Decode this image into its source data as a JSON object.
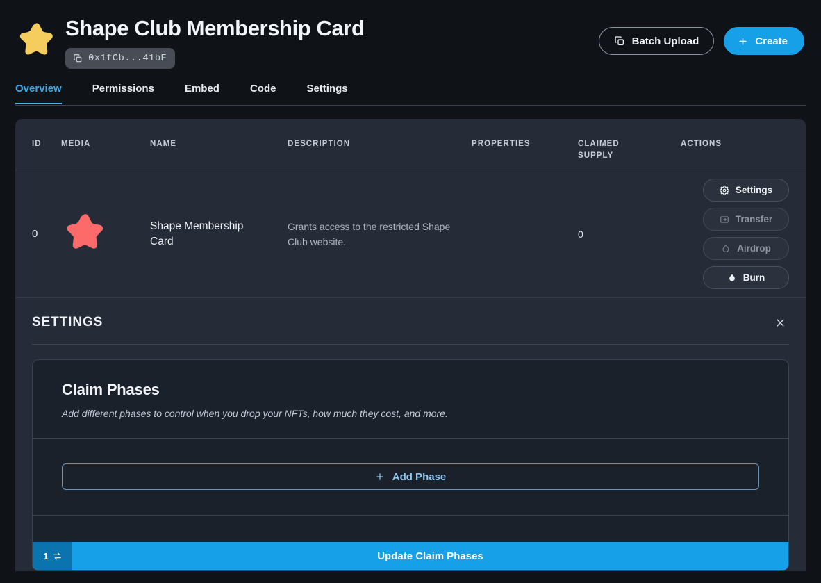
{
  "header": {
    "title": "Shape Club Membership Card",
    "address": "0x1fCb...41bF",
    "logo_icon": "star-icon",
    "copy_icon": "copy-icon",
    "batch_upload_label": "Batch Upload",
    "batch_upload_icon": "layers-copy-icon",
    "create_label": "Create",
    "create_icon": "plus-icon",
    "accent_color": "#15a0e8",
    "logo_color": "#f5cc5e"
  },
  "tabs": [
    {
      "label": "Overview",
      "active": true
    },
    {
      "label": "Permissions",
      "active": false
    },
    {
      "label": "Embed",
      "active": false
    },
    {
      "label": "Code",
      "active": false
    },
    {
      "label": "Settings",
      "active": false
    }
  ],
  "table": {
    "columns": {
      "id": "ID",
      "media": "MEDIA",
      "name": "NAME",
      "description": "DESCRIPTION",
      "properties": "PROPERTIES",
      "claimed_supply_line1": "CLAIMED",
      "claimed_supply_line2": "SUPPLY",
      "actions": "ACTIONS"
    },
    "rows": [
      {
        "id": "0",
        "media_icon": "star-icon",
        "media_color": "#fc6a6a",
        "name": "Shape Membership Card",
        "description": "Grants access to the restricted Shape Club website.",
        "properties": "",
        "claimed_supply": "0",
        "actions": [
          {
            "label": "Settings",
            "icon": "gear-icon",
            "dim": false
          },
          {
            "label": "Transfer",
            "icon": "transfer-box-icon",
            "dim": true
          },
          {
            "label": "Airdrop",
            "icon": "droplet-outline-icon",
            "dim": true
          },
          {
            "label": "Burn",
            "icon": "droplet-filled-icon",
            "dim": false
          }
        ]
      }
    ]
  },
  "settings_panel": {
    "title": "SETTINGS",
    "close_icon": "close-icon",
    "claim_phases": {
      "title": "Claim Phases",
      "subtitle": "Add different phases to control when you drop your NFTs, how much they cost, and more.",
      "add_phase_label": "Add Phase",
      "add_phase_icon": "plus-icon"
    },
    "footer": {
      "tx_count": "1",
      "tx_icon": "swap-arrows-icon",
      "update_label": "Update Claim Phases"
    }
  }
}
